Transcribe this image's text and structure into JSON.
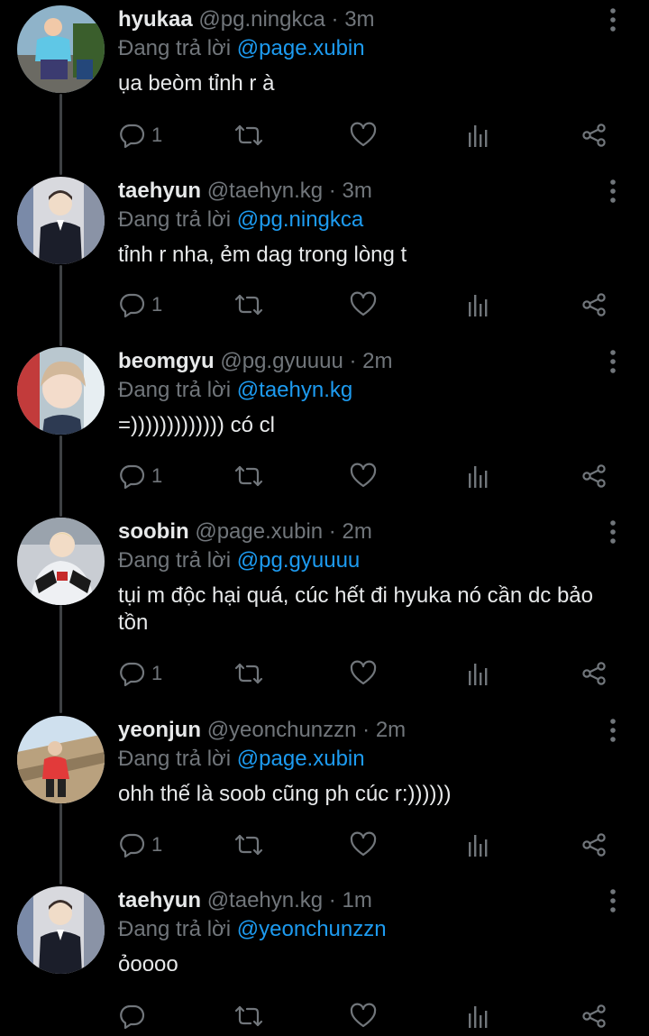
{
  "reply_prefix": "Đang trả lời",
  "tweets": [
    {
      "name": "hyukaa",
      "handle": "@pg.ningkca",
      "time": "3m",
      "reply_to": "@page.xubin",
      "text": "ụa beòm tỉnh r à",
      "reply_count": "1"
    },
    {
      "name": "taehyun",
      "handle": "@taehyn.kg",
      "time": "3m",
      "reply_to": "@pg.ningkca",
      "text": "tỉnh r nha, ẻm dag trong lòng t",
      "reply_count": "1"
    },
    {
      "name": "beomgyu",
      "handle": "@pg.gyuuuu",
      "time": "2m",
      "reply_to": "@taehyn.kg",
      "text": "=))))))))))))) có cl",
      "reply_count": "1"
    },
    {
      "name": "soobin",
      "handle": "@page.xubin",
      "time": "2m",
      "reply_to": "@pg.gyuuuu",
      "text": "tụi m độc hại quá, cúc hết đi hyuka nó cần dc bảo tồn",
      "reply_count": "1"
    },
    {
      "name": "yeonjun",
      "handle": "@yeonchunzzn",
      "time": "2m",
      "reply_to": "@page.xubin",
      "text": "ohh thế là soob cũng ph cúc r:))))))",
      "reply_count": "1"
    },
    {
      "name": "taehyun",
      "handle": "@taehyn.kg",
      "time": "1m",
      "reply_to": "@yeonchunzzn",
      "text": "ỏoooo",
      "reply_count": ""
    }
  ],
  "icons": {
    "reply": "comment-bubble-icon",
    "retweet": "retweet-icon",
    "like": "heart-icon",
    "views": "analytics-icon",
    "share": "share-icon",
    "more": "more-vertical-icon"
  },
  "colors": {
    "background": "#000000",
    "name": "#e7e9ea",
    "muted": "#71767b",
    "mention": "#1d9bf0",
    "thread_line": "#3e4144"
  }
}
